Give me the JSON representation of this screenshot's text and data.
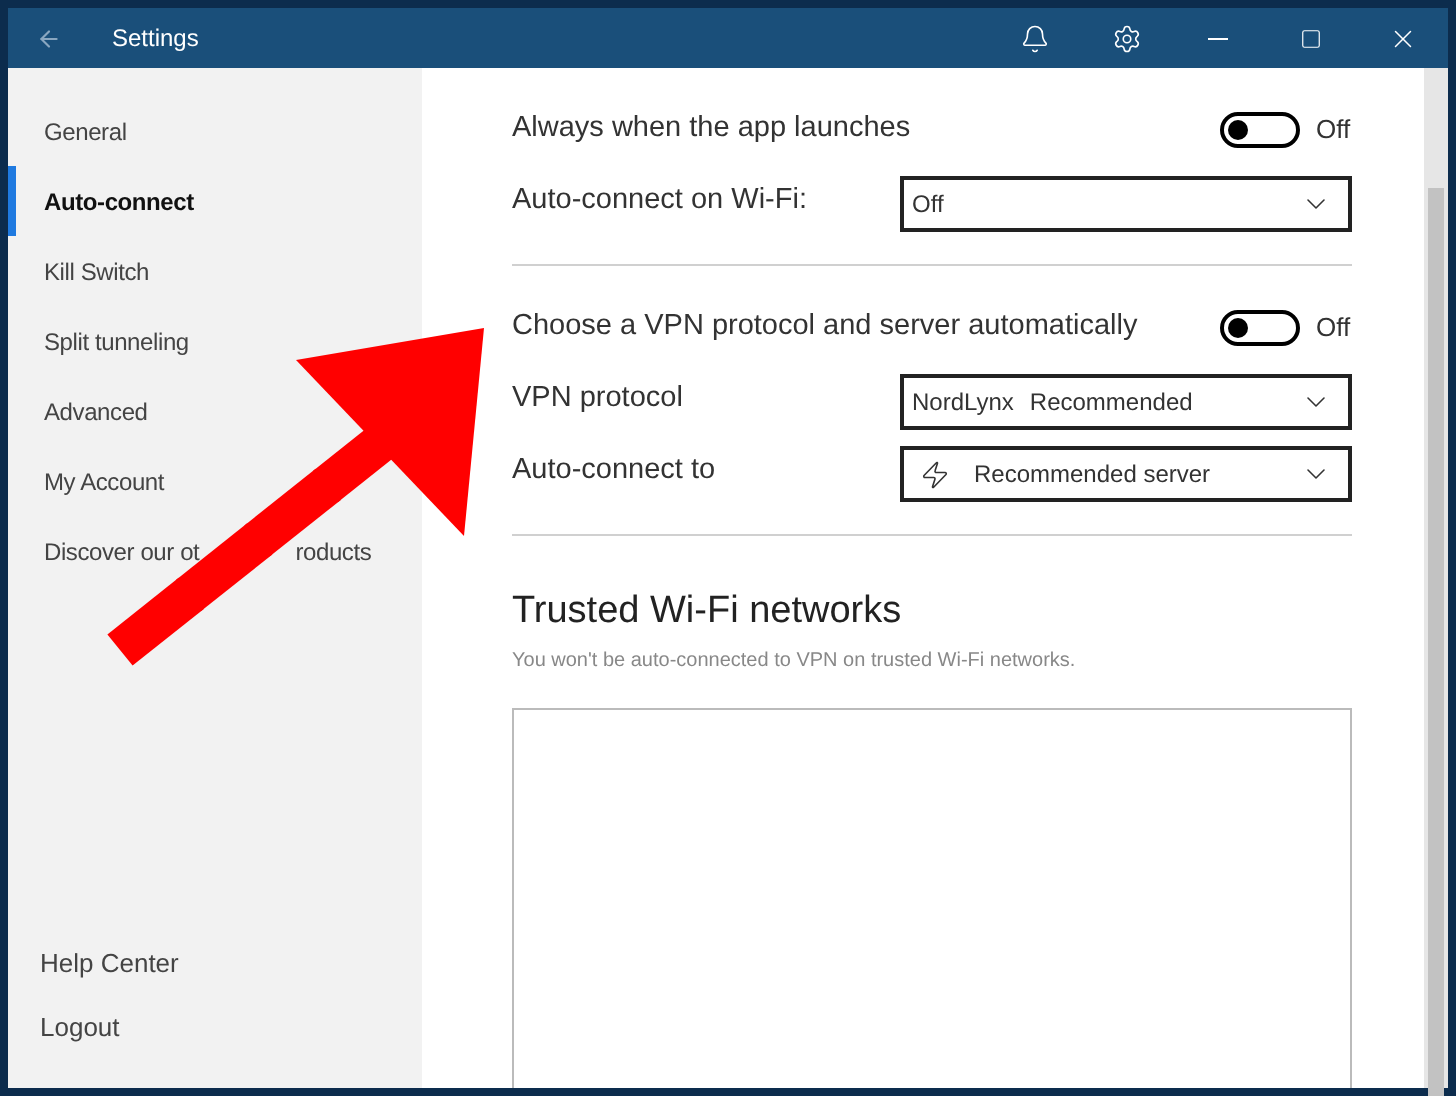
{
  "window": {
    "title": "Settings"
  },
  "sidebar": {
    "items": [
      {
        "label": "General",
        "selected": false
      },
      {
        "label": "Auto-connect",
        "selected": true
      },
      {
        "label": "Kill Switch",
        "selected": false
      },
      {
        "label": "Split tunneling",
        "selected": false
      },
      {
        "label": "Advanced",
        "selected": false
      },
      {
        "label": "My Account",
        "selected": false
      },
      {
        "label": "Discover our ot",
        "label_tail": "roducts",
        "selected": false
      }
    ],
    "footer": [
      "Help Center",
      "Logout"
    ]
  },
  "settings": [
    {
      "kind": "toggle",
      "label": "Always when the app launches",
      "on": false,
      "state_text": "Off"
    },
    {
      "kind": "dropdown",
      "label": "Auto-connect on Wi-Fi:",
      "value": "Off"
    },
    {
      "kind": "divider"
    },
    {
      "kind": "toggle",
      "label": "Choose a VPN protocol and server automatically",
      "on": false,
      "state_text": "Off"
    },
    {
      "kind": "dropdown",
      "label": "VPN protocol",
      "value": "NordLynx",
      "hint": "Recommended"
    },
    {
      "kind": "server_dropdown",
      "label": "Auto-connect to",
      "value": "Recommended server"
    },
    {
      "kind": "divider"
    }
  ],
  "trusted": {
    "title": "Trusted Wi-Fi networks",
    "subtitle": "You won't be auto-connected to VPN on trusted Wi-Fi networks."
  }
}
